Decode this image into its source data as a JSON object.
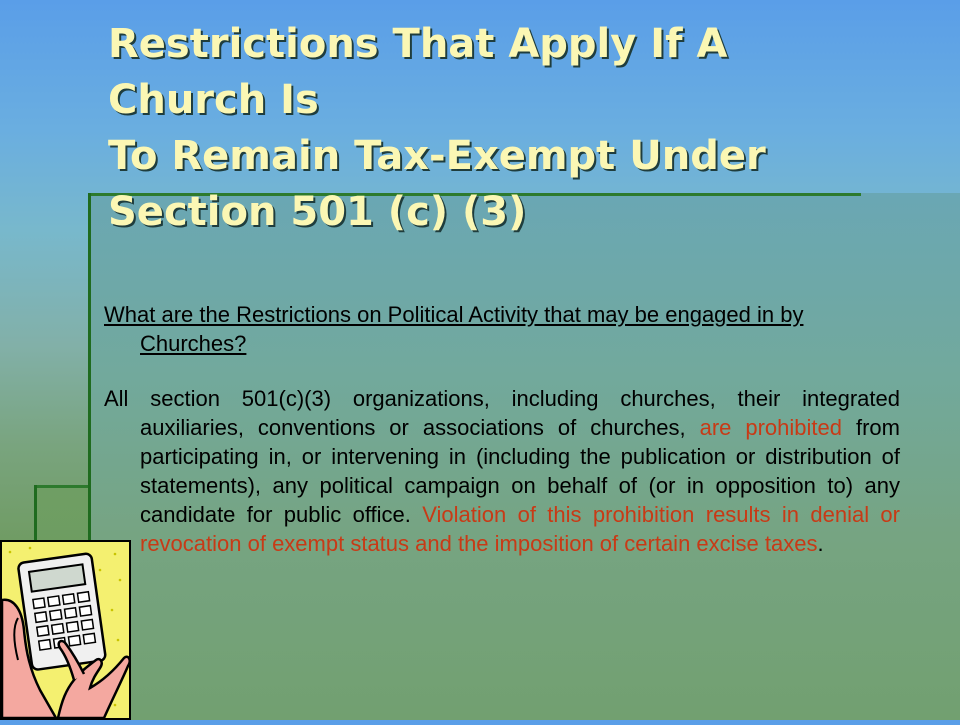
{
  "slide": {
    "title_lines": [
      "Restrictions That Apply If A",
      "Church Is",
      "To Remain Tax-Exempt Under",
      "Section 501 (c) (3)"
    ],
    "question": "What are the Restrictions on Political Activity that may be engaged in by Churches?",
    "para": {
      "t1": "All section 501(c)(3) organizations, including churches, their integrated auxiliaries, conventions or associations of churches, ",
      "t2_red": "are prohibited",
      "t3": " from participating in, or intervening in (including the publication or distribution of statements), any political campaign on behalf of (or in opposition to) any candidate for public office. ",
      "t4_red": "Violation of this prohibition results in denial or revocation of exempt status and the imposition of certain excise taxes",
      "t5": "."
    }
  },
  "colors": {
    "title": "#fbf7b4",
    "emphasis_red": "#c83a16",
    "panel_border": "#1f6b1f"
  },
  "clipart": {
    "icon": "calculator-hand-icon"
  }
}
